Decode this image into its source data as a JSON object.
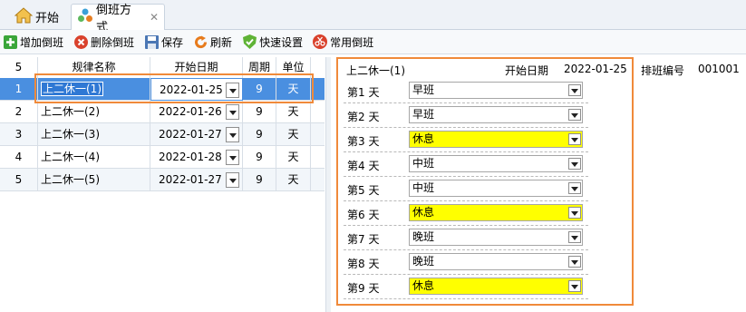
{
  "tabs": {
    "home": "开始",
    "active": "倒班方式"
  },
  "toolbar": {
    "add": "增加倒班",
    "delete": "删除倒班",
    "save": "保存",
    "refresh": "刷新",
    "quick": "快速设置",
    "common": "常用倒班"
  },
  "grid": {
    "row_count": "5",
    "headers": {
      "name": "规律名称",
      "date": "开始日期",
      "period": "周期",
      "unit": "单位"
    },
    "rows": [
      {
        "num": "1",
        "name": "上二休一(1)",
        "date": "2022-01-25",
        "period": "9",
        "unit": "天"
      },
      {
        "num": "2",
        "name": "上二休一(2)",
        "date": "2022-01-26",
        "period": "9",
        "unit": "天"
      },
      {
        "num": "3",
        "name": "上二休一(3)",
        "date": "2022-01-27",
        "period": "9",
        "unit": "天"
      },
      {
        "num": "4",
        "name": "上二休一(4)",
        "date": "2022-01-28",
        "period": "9",
        "unit": "天"
      },
      {
        "num": "5",
        "name": "上二休一(5)",
        "date": "2022-01-27",
        "period": "9",
        "unit": "天"
      }
    ]
  },
  "detail": {
    "title": "上二休一(1)",
    "date_label": "开始日期",
    "date": "2022-01-25",
    "code_label": "排班编号",
    "code": "001001",
    "days": [
      {
        "label": "第1 天",
        "shift": "早班"
      },
      {
        "label": "第2 天",
        "shift": "早班"
      },
      {
        "label": "第3 天",
        "shift": "休息"
      },
      {
        "label": "第4 天",
        "shift": "中班"
      },
      {
        "label": "第5 天",
        "shift": "中班"
      },
      {
        "label": "第6 天",
        "shift": "休息"
      },
      {
        "label": "第7 天",
        "shift": "晚班"
      },
      {
        "label": "第8 天",
        "shift": "晚班"
      },
      {
        "label": "第9 天",
        "shift": "休息"
      }
    ]
  },
  "colors": {
    "selected_row": "#4a8fe0",
    "highlight_box": "#f08a3a",
    "rest_day": "#ffff00"
  }
}
